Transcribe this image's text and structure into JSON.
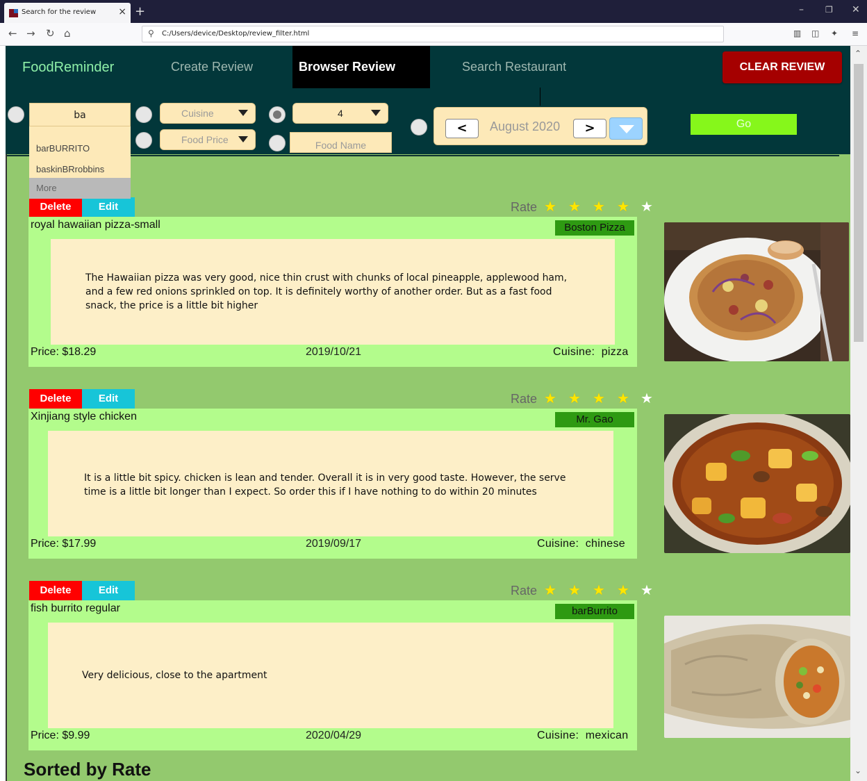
{
  "browser": {
    "tab_title": "Search for the review",
    "url": "C:/Users/device/Desktop/review_filter.html"
  },
  "app": {
    "logo": "FoodReminder",
    "nav": [
      "Create Review",
      "Browser Review",
      "Search Restaurant"
    ],
    "clear_button": "CLEAR REVIEW"
  },
  "filters": {
    "search_value": "ba",
    "suggestions": [
      "barBURRITO",
      "baskinBRrobbins"
    ],
    "suggestions_more": "More",
    "cuisine_placeholder": "Cuisine",
    "food_price_placeholder": "Food Price",
    "rate_value": "4",
    "food_name_placeholder": "Food Name",
    "month_prev": "<",
    "month_label": "August 2020",
    "month_next": ">",
    "go_button": "Go"
  },
  "labels": {
    "delete": "Delete",
    "edit": "Edit",
    "rate": "Rate",
    "cuisine_prefix": "Cuisine:"
  },
  "reviews": [
    {
      "food": "royal hawaiian pizza-small",
      "restaurant": "Boston Pizza",
      "text": "The Hawaiian pizza was very good, nice thin crust with chunks of local pineapple, applewood ham, and a few red onions sprinkled on top. It is definitely worthy of another order. But as a fast food snack, the price is a little bit higher",
      "price": "Price: $18.29",
      "date": "2019/10/21",
      "cuisine": "pizza",
      "rating": 4
    },
    {
      "food": "Xinjiang style chicken",
      "restaurant": "Mr. Gao",
      "text": "It is a little bit spicy. chicken is lean and tender. Overall it is in very good taste. However, the serve time is a little bit longer than I expect.  So order this if I have nothing to do within 20 minutes",
      "price": "Price: $17.99",
      "date": "2019/09/17",
      "cuisine": "chinese",
      "rating": 4
    },
    {
      "food": "fish burrito regular",
      "restaurant": "barBurrito",
      "text": "Very delicious, close to the apartment",
      "price": "Price: $9.99",
      "date": "2020/04/29",
      "cuisine": "mexican",
      "rating": 4
    }
  ],
  "footer": {
    "sorted_label": "Sorted by Rate"
  },
  "colors": {
    "header_bg": "#02373a",
    "page_bg": "#93c96e",
    "card_bg": "#b3fc8c",
    "review_bg": "#fdefc8",
    "delete": "#ff0000",
    "edit": "#17c5d8",
    "clear": "#a50000",
    "go": "#86f71b"
  }
}
